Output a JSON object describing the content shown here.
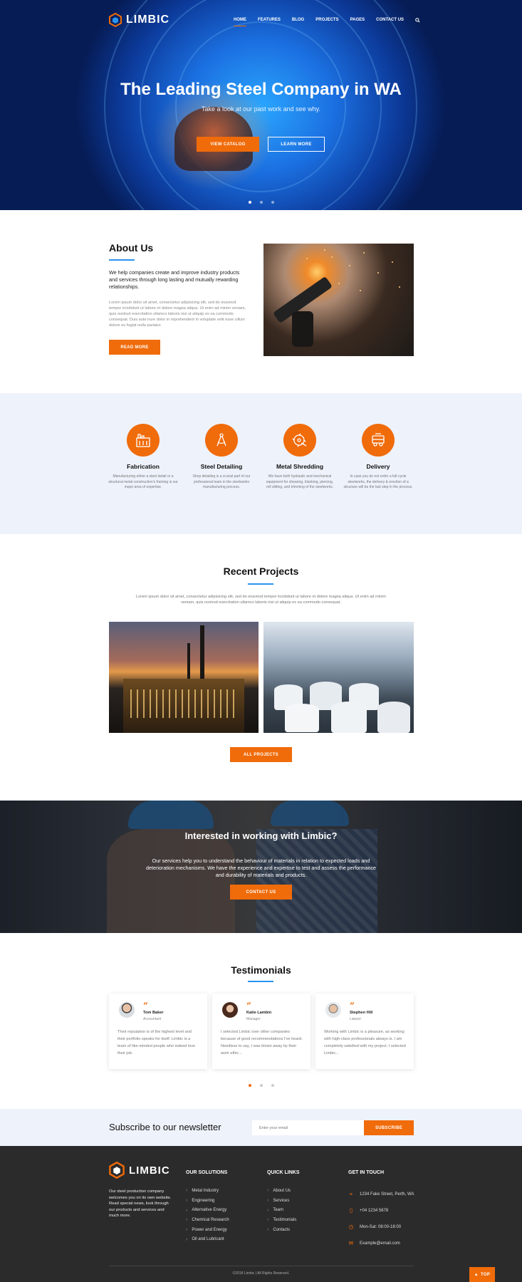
{
  "brand": {
    "name": "LIMBIC",
    "accent": "#f06b0a",
    "secondary": "#2a93f0"
  },
  "nav": {
    "items": [
      "HOME",
      "FEATURES",
      "BLOG",
      "PROJECTS",
      "PAGES",
      "CONTACT US"
    ],
    "active": "HOME",
    "search_icon": "search-icon"
  },
  "hero": {
    "title": "The Leading Steel Company in WA",
    "subtitle": "Take a look at our past work and see why.",
    "primary_button": "VIEW CATALOG",
    "secondary_button": "LEARN MORE",
    "slides": 3,
    "active_slide": 1
  },
  "about": {
    "title": "About Us",
    "lead": "We help companies create and improve industry products and services through long lasting and mutually rewarding relationships.",
    "body": "Lorem ipsum dolor sit amet, consectetur adipisicing elit, sed do eiusmod tempor incididunt ut labore et dolore magna aliqua. Ut enim ad minim veniam, quis nostrud exercitation ullamco laboris nisi ut aliquip ex ea commodo consequat. Duis aute irure dolor in reprehenderit in voluptate velit esse cillum dolore eu fugiat nulla pariatur.",
    "button": "READ MORE"
  },
  "services": [
    {
      "title": "Fabrication",
      "text": "Manufacturing either a steel detail or a structural metal construction's framing is our major area of expertise.",
      "icon": "factory-icon"
    },
    {
      "title": "Steel Detailing",
      "text": "Shop detailing is a crucial part of our professional team in the steelworks manufacturing process.",
      "icon": "compass-icon"
    },
    {
      "title": "Metal Shredding",
      "text": "We have both hydraulic and mechanical equipment for shearing, blanking, piercing, roll slitting, and trimming of the steelworks.",
      "icon": "saw-blade-icon"
    },
    {
      "title": "Delivery",
      "text": "In case you do not order a full-cycle steelworks, the delivery & erection of a structure will be the last step in the process.",
      "icon": "truck-icon"
    }
  ],
  "projects": {
    "title": "Recent Projects",
    "description": "Lorem ipsum dolor sit amet, consectetur adipisicing elit, sed do eiusmod tempor incididunt ut labore et dolore magna aliqua. Ut enim ad minim veniam, quis nostrud exercitation ullamco laboris nisi ut aliquip ex ea commodo consequat.",
    "button": "ALL PROJECTS"
  },
  "cta": {
    "title": "Interested in working with Limbic?",
    "text": "Our services help you to understand the behaviour of materials in relation to expected loads and deterioration mechanisms. We have the experience and expertise to test and assess the performance and durability of materials and products.",
    "button": "CONTACT US"
  },
  "testimonials": {
    "title": "Testimonials",
    "items": [
      {
        "name": "Tom Baker",
        "role": "Accountant",
        "text": "Their reputation is of the highest level and their portfolio speaks for itself. Limbic is a team of like-minded people who indeed love their job."
      },
      {
        "name": "Katie Lambin",
        "role": "Manager",
        "text": "I selected Limbic over other companies because of good recommendations I've heard. Needless to say, I was blown away by their work ethic..."
      },
      {
        "name": "Stephen Hill",
        "role": "Lawyer",
        "text": "Working with Limbic is a pleasure, as working with high-class professionals always is. I am completely satisfied with my project. I selected Limbic..."
      }
    ],
    "slides": 3,
    "active_slide": 1
  },
  "newsletter": {
    "title": "Subscribe to our newsletter",
    "placeholder": "Enter your email",
    "button": "SUBSCRIBE"
  },
  "footer": {
    "about": "Our steel production company welcomes you on its own website. Read special news, look through our products and services and much more.",
    "solutions_title": "OUR SOLUTIONS",
    "solutions": [
      "Metal Industry",
      "Engineering",
      "Alternative Energy",
      "Chemical Research",
      "Power and Energy",
      "Oil and Lubricant"
    ],
    "links_title": "QUICK LINKS",
    "links": [
      "About Us",
      "Services",
      "Team",
      "Testimonials",
      "Contacts"
    ],
    "contact_title": "GET IN TOUCH",
    "address": "1234 Fake Street, Perth, WA",
    "phone": "+04 1234 5678",
    "hours": "Mon-Sat: 08:00-18:00",
    "email": "Example@email.com",
    "copyright": "©2018 Limbic  |  All Rights Reserved.",
    "top_button": "TOP"
  }
}
